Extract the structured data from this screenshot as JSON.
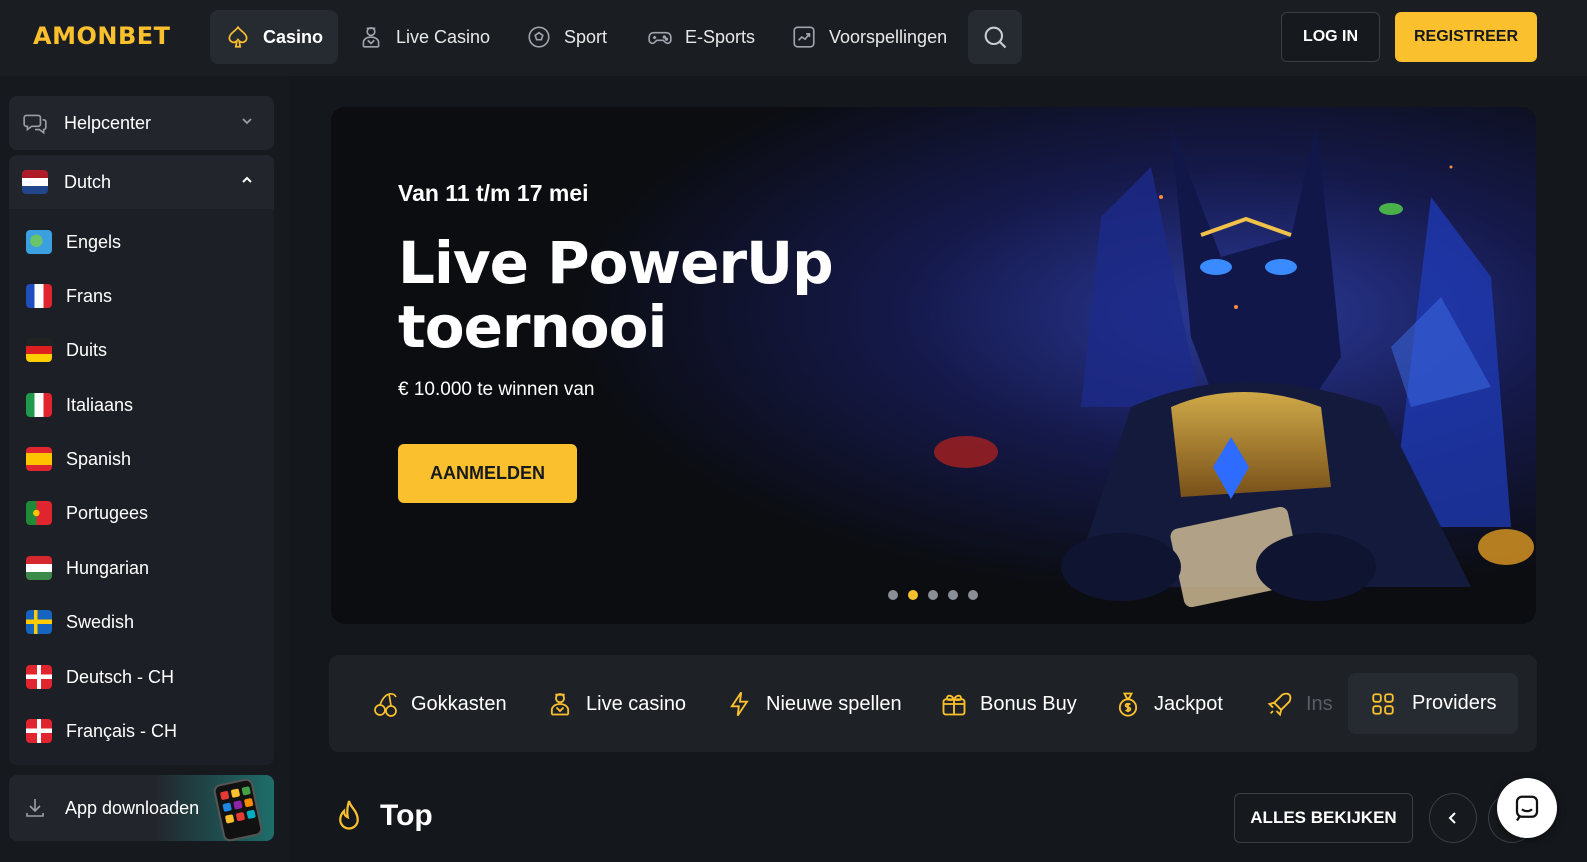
{
  "header": {
    "logo": "AMONBET",
    "nav": [
      {
        "label": "Casino",
        "icon": "spade-icon"
      },
      {
        "label": "Live Casino",
        "icon": "dealer-icon"
      },
      {
        "label": "Sport",
        "icon": "soccer-ball-icon"
      },
      {
        "label": "E-Sports",
        "icon": "gamepad-icon"
      },
      {
        "label": "Voorspellingen",
        "icon": "trend-chart-icon"
      }
    ],
    "login": "LOG IN",
    "register": "REGISTREER"
  },
  "sidebar": {
    "helpcenter": "Helpcenter",
    "language": "Dutch",
    "languages": [
      "Engels",
      "Frans",
      "Duits",
      "Italiaans",
      "Spanish",
      "Portugees",
      "Hungarian",
      "Swedish",
      "Deutsch - CH",
      "Français - CH"
    ],
    "app_download": "App downloaden"
  },
  "banner": {
    "subtitle": "Van 11 t/m 17 mei",
    "title": "Live PowerUp toernooi",
    "description": "€ 10.000 te winnen van",
    "cta": "AANMELDEN",
    "slides": 5,
    "active_slide": 2
  },
  "categories": [
    {
      "label": "Gokkasten",
      "icon": "cherries-icon"
    },
    {
      "label": "Live casino",
      "icon": "dealer-icon"
    },
    {
      "label": "Nieuwe spellen",
      "icon": "lightning-icon"
    },
    {
      "label": "Bonus Buy",
      "icon": "gift-icon"
    },
    {
      "label": "Jackpot",
      "icon": "money-bag-icon"
    },
    {
      "label": "Ins",
      "icon": "rocket-icon"
    }
  ],
  "providers": "Providers",
  "top_section": {
    "title": "Top",
    "view_all": "ALLES BEKIJKEN"
  },
  "colors": {
    "accent": "#fbc02d",
    "background": "#14171c",
    "panel": "#1e2126"
  }
}
